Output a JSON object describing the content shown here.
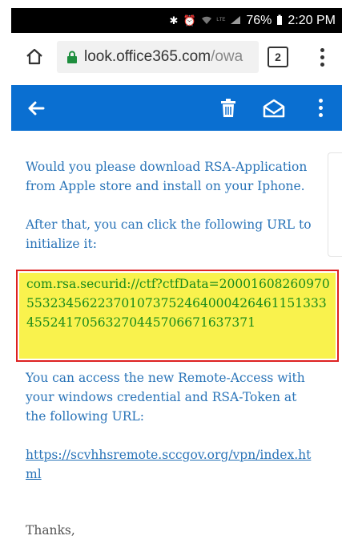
{
  "status_bar": {
    "icons": [
      "bluetooth-icon",
      "alarm-icon",
      "wifi-icon",
      "lte-icon",
      "signal-icon"
    ],
    "battery": "76%",
    "battery_icon": "battery-icon",
    "time": "2:20 PM"
  },
  "browser": {
    "url_main": "look.office365.com",
    "url_path": "/owa",
    "tab_count": "2",
    "home_icon": "home-icon",
    "lock_icon": "lock-icon",
    "menu_icon": "more-vertical-icon"
  },
  "toolbar": {
    "color": "#0a6fd1",
    "back_icon": "arrow-left-icon",
    "delete_icon": "trash-icon",
    "read_icon": "mark-read-icon",
    "more_icon": "more-vertical-icon"
  },
  "message": {
    "para1": "Would you please download RSA-Application from Apple store and install on your Iphone.",
    "para2": "After that, you can click the following URL to initialize it:",
    "rsa_url": "com.rsa.securid://ctf?ctfData=200016082609705532345622370107375246400042646115133345524170563270445706671637371",
    "para4": "You can access the new Remote-Access with your windows credential and RSA-Token at the following URL:",
    "vpn_link": "https://scvhhsremote.sccgov.org/vpn/index.html",
    "closing": "Thanks,",
    "link_color": "#2a74b8",
    "highlight_color": "#f9f24d",
    "frame_color": "#dd2222"
  }
}
